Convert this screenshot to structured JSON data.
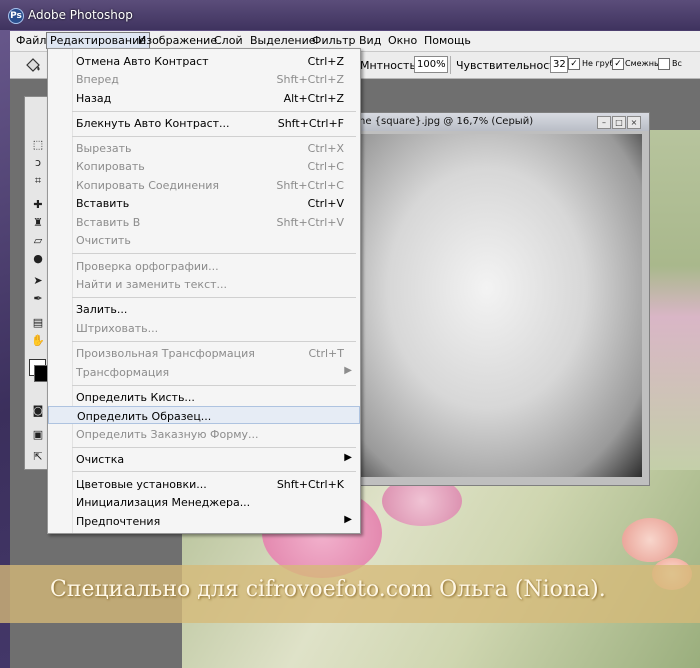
{
  "app": {
    "title": "Adobe Photoshop",
    "icon": "photoshop-icon"
  },
  "menubar": {
    "items": [
      "Файл",
      "Редактирование",
      "Изображение",
      "Слой",
      "Выделение",
      "Фильтр",
      "Вид",
      "Окно",
      "Помощь"
    ],
    "active": "Редактирование"
  },
  "options": {
    "opacity_label": "Мнтность:",
    "opacity_value": "100%",
    "tolerance_label": "Чувствительность:",
    "tolerance_value": "32",
    "anti_alias_label": "Не грубо",
    "anti_alias_checked": true,
    "contiguous_label": "Смежный",
    "contiguous_checked": true,
    "all_layers_label": "Вс",
    "all_layers_checked": false
  },
  "document": {
    "title": "ne {square}.jpg @ 16,7% (Серый)"
  },
  "edit_menu": {
    "items": [
      {
        "label": "Отмена Авто Контраст",
        "shortcut": "Ctrl+Z",
        "enabled": true
      },
      {
        "label": "Вперед",
        "shortcut": "Shft+Ctrl+Z",
        "enabled": false
      },
      {
        "label": "Назад",
        "shortcut": "Alt+Ctrl+Z",
        "enabled": true
      },
      {
        "label": "Блекнуть Авто Контраст...",
        "shortcut": "Shft+Ctrl+F",
        "enabled": true
      },
      {
        "label": "Вырезать",
        "shortcut": "Ctrl+X",
        "enabled": false
      },
      {
        "label": "Копировать",
        "shortcut": "Ctrl+C",
        "enabled": false
      },
      {
        "label": "Копировать Соединения",
        "shortcut": "Shft+Ctrl+C",
        "enabled": false
      },
      {
        "label": "Вставить",
        "shortcut": "Ctrl+V",
        "enabled": true
      },
      {
        "label": "Вставить В",
        "shortcut": "Shft+Ctrl+V",
        "enabled": false
      },
      {
        "label": "Очистить",
        "shortcut": "",
        "enabled": false
      },
      {
        "label": "Проверка орфографии...",
        "shortcut": "",
        "enabled": false
      },
      {
        "label": "Найти и заменить текст...",
        "shortcut": "",
        "enabled": false
      },
      {
        "label": "Залить...",
        "shortcut": "",
        "enabled": true
      },
      {
        "label": "Штриховать...",
        "shortcut": "",
        "enabled": false
      },
      {
        "label": "Произвольная Трансформация",
        "shortcut": "Ctrl+T",
        "enabled": false
      },
      {
        "label": "Трансформация",
        "shortcut": "",
        "enabled": false,
        "submenu": true
      },
      {
        "label": "Определить Кисть...",
        "shortcut": "",
        "enabled": true
      },
      {
        "label": "Определить Образец...",
        "shortcut": "",
        "enabled": true,
        "highlighted": true
      },
      {
        "label": "Определить Заказную Форму...",
        "shortcut": "",
        "enabled": false
      },
      {
        "label": "Очистка",
        "shortcut": "",
        "enabled": true,
        "submenu": true
      },
      {
        "label": "Цветовые установки...",
        "shortcut": "Shft+Ctrl+K",
        "enabled": true
      },
      {
        "label": "Инициализация Менеджера...",
        "shortcut": "",
        "enabled": true
      },
      {
        "label": "Предпочтения",
        "shortcut": "",
        "enabled": true,
        "submenu": true
      }
    ]
  },
  "watermark": {
    "text": "Специально для cifrovoefoto.com Ольга (Niona)."
  },
  "tools": [
    "marquee-tool-icon",
    "lasso-tool-icon",
    "crop-tool-icon",
    "healing-tool-icon",
    "stamp-tool-icon",
    "eraser-tool-icon",
    "blur-tool-icon",
    "move-tool-icon",
    "pen-tool-icon",
    "notes-tool-icon",
    "hand-tool-icon"
  ],
  "colors": {
    "menu_bg": "#f5f5f5",
    "highlight": "#e6ecf5",
    "disabled_text": "#8c8c8c",
    "watermark_band": "#d6ba78"
  }
}
